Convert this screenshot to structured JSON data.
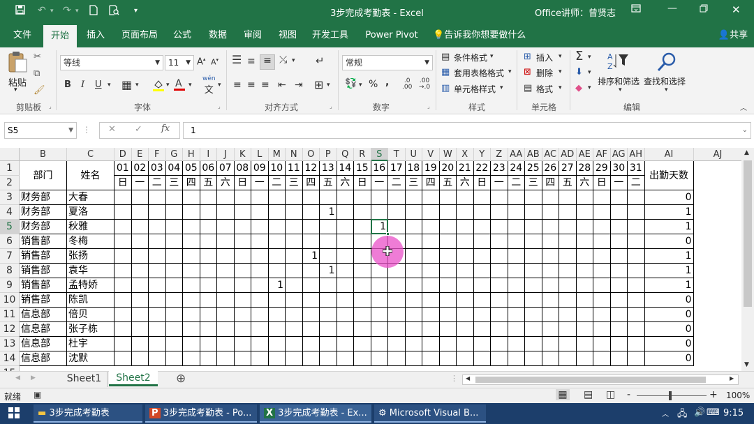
{
  "titlebar": {
    "title": "3步完成考勤表  -  Excel",
    "user": "Office讲师：曾贤志",
    "icons": [
      "save-icon",
      "undo-icon",
      "redo-icon",
      "new-icon",
      "print-preview-icon",
      "customize-icon"
    ],
    "win_controls": [
      "ribbon-display-icon",
      "minimize-icon",
      "restore-icon",
      "close-icon"
    ]
  },
  "tabs": [
    "文件",
    "开始",
    "插入",
    "页面布局",
    "公式",
    "数据",
    "审阅",
    "视图",
    "开发工具",
    "Power Pivot"
  ],
  "tell_me": "告诉我你想要做什么",
  "share": "共享",
  "ribbon": {
    "clipboard": {
      "paste": "粘贴",
      "label": "剪贴板"
    },
    "font": {
      "name": "等线",
      "size": "11",
      "label": "字体",
      "wen": "wén"
    },
    "alignment": {
      "label": "对齐方式"
    },
    "number": {
      "format": "常规",
      "label": "数字",
      "percent": "%"
    },
    "styles": {
      "cond": "条件格式",
      "table": "套用表格格式",
      "cell": "单元格样式",
      "label": "样式"
    },
    "cells": {
      "insert": "插入",
      "delete": "删除",
      "format": "格式",
      "label": "单元格"
    },
    "editing": {
      "sort": "排序和筛选",
      "find": "查找和选择",
      "label": "编辑",
      "sigma": "Σ"
    }
  },
  "formula": {
    "namebox": "S5",
    "fx": "fx",
    "value": "1"
  },
  "columns": [
    "B",
    "C",
    "D",
    "E",
    "F",
    "G",
    "H",
    "I",
    "J",
    "K",
    "L",
    "M",
    "N",
    "O",
    "P",
    "Q",
    "R",
    "S",
    "T",
    "U",
    "V",
    "W",
    "X",
    "Y",
    "Z",
    "AA",
    "AB",
    "AC",
    "AD",
    "AE",
    "AF",
    "AG",
    "AH",
    "AI",
    "AJ"
  ],
  "selected_column": "S",
  "selected_row": 5,
  "header": {
    "dept": "部门",
    "name": "姓名",
    "days_label": "出勤天数"
  },
  "day_numbers": [
    "01",
    "02",
    "03",
    "04",
    "05",
    "06",
    "07",
    "08",
    "09",
    "10",
    "11",
    "12",
    "13",
    "14",
    "15",
    "16",
    "17",
    "18",
    "19",
    "20",
    "21",
    "22",
    "23",
    "24",
    "25",
    "26",
    "27",
    "28",
    "29",
    "30",
    "31"
  ],
  "weekdays": [
    "日",
    "一",
    "二",
    "三",
    "四",
    "五",
    "六",
    "日",
    "一",
    "二",
    "三",
    "四",
    "五",
    "六",
    "日",
    "一",
    "二",
    "三",
    "四",
    "五",
    "六",
    "日",
    "一",
    "二",
    "三",
    "四",
    "五",
    "六",
    "日",
    "一",
    "二"
  ],
  "rows": [
    {
      "row": 3,
      "dept": "财务部",
      "name": "大春",
      "marks": {},
      "total": "0"
    },
    {
      "row": 4,
      "dept": "财务部",
      "name": "夏洛",
      "marks": {
        "13": "1"
      },
      "total": "1"
    },
    {
      "row": 5,
      "dept": "财务部",
      "name": "秋雅",
      "marks": {
        "16": "1"
      },
      "total": "1"
    },
    {
      "row": 6,
      "dept": "销售部",
      "name": "冬梅",
      "marks": {},
      "total": "0"
    },
    {
      "row": 7,
      "dept": "销售部",
      "name": "张扬",
      "marks": {
        "12": "1"
      },
      "total": "1"
    },
    {
      "row": 8,
      "dept": "销售部",
      "name": "袁华",
      "marks": {
        "13": "1"
      },
      "total": "1"
    },
    {
      "row": 9,
      "dept": "销售部",
      "name": "孟特娇",
      "marks": {
        "10": "1"
      },
      "total": "1"
    },
    {
      "row": 10,
      "dept": "销售部",
      "name": "陈凯",
      "marks": {},
      "total": "0"
    },
    {
      "row": 11,
      "dept": "信息部",
      "name": "倍贝",
      "marks": {},
      "total": "0"
    },
    {
      "row": 12,
      "dept": "信息部",
      "name": "张子栋",
      "marks": {},
      "total": "0"
    },
    {
      "row": 13,
      "dept": "信息部",
      "name": "杜宇",
      "marks": {},
      "total": "0"
    },
    {
      "row": 14,
      "dept": "信息部",
      "name": "沈默",
      "marks": {},
      "total": "0"
    }
  ],
  "sheets": [
    "Sheet1",
    "Sheet2"
  ],
  "active_sheet": "Sheet2",
  "status": {
    "ready": "就绪",
    "zoom": "100%",
    "minus": "-",
    "plus": "+"
  },
  "taskbar": {
    "items": [
      "3步完成考勤表",
      "3步完成考勤表 - Po...",
      "3步完成考勤表 - Ex...",
      "Microsoft Visual B..."
    ],
    "time": "9:15"
  }
}
